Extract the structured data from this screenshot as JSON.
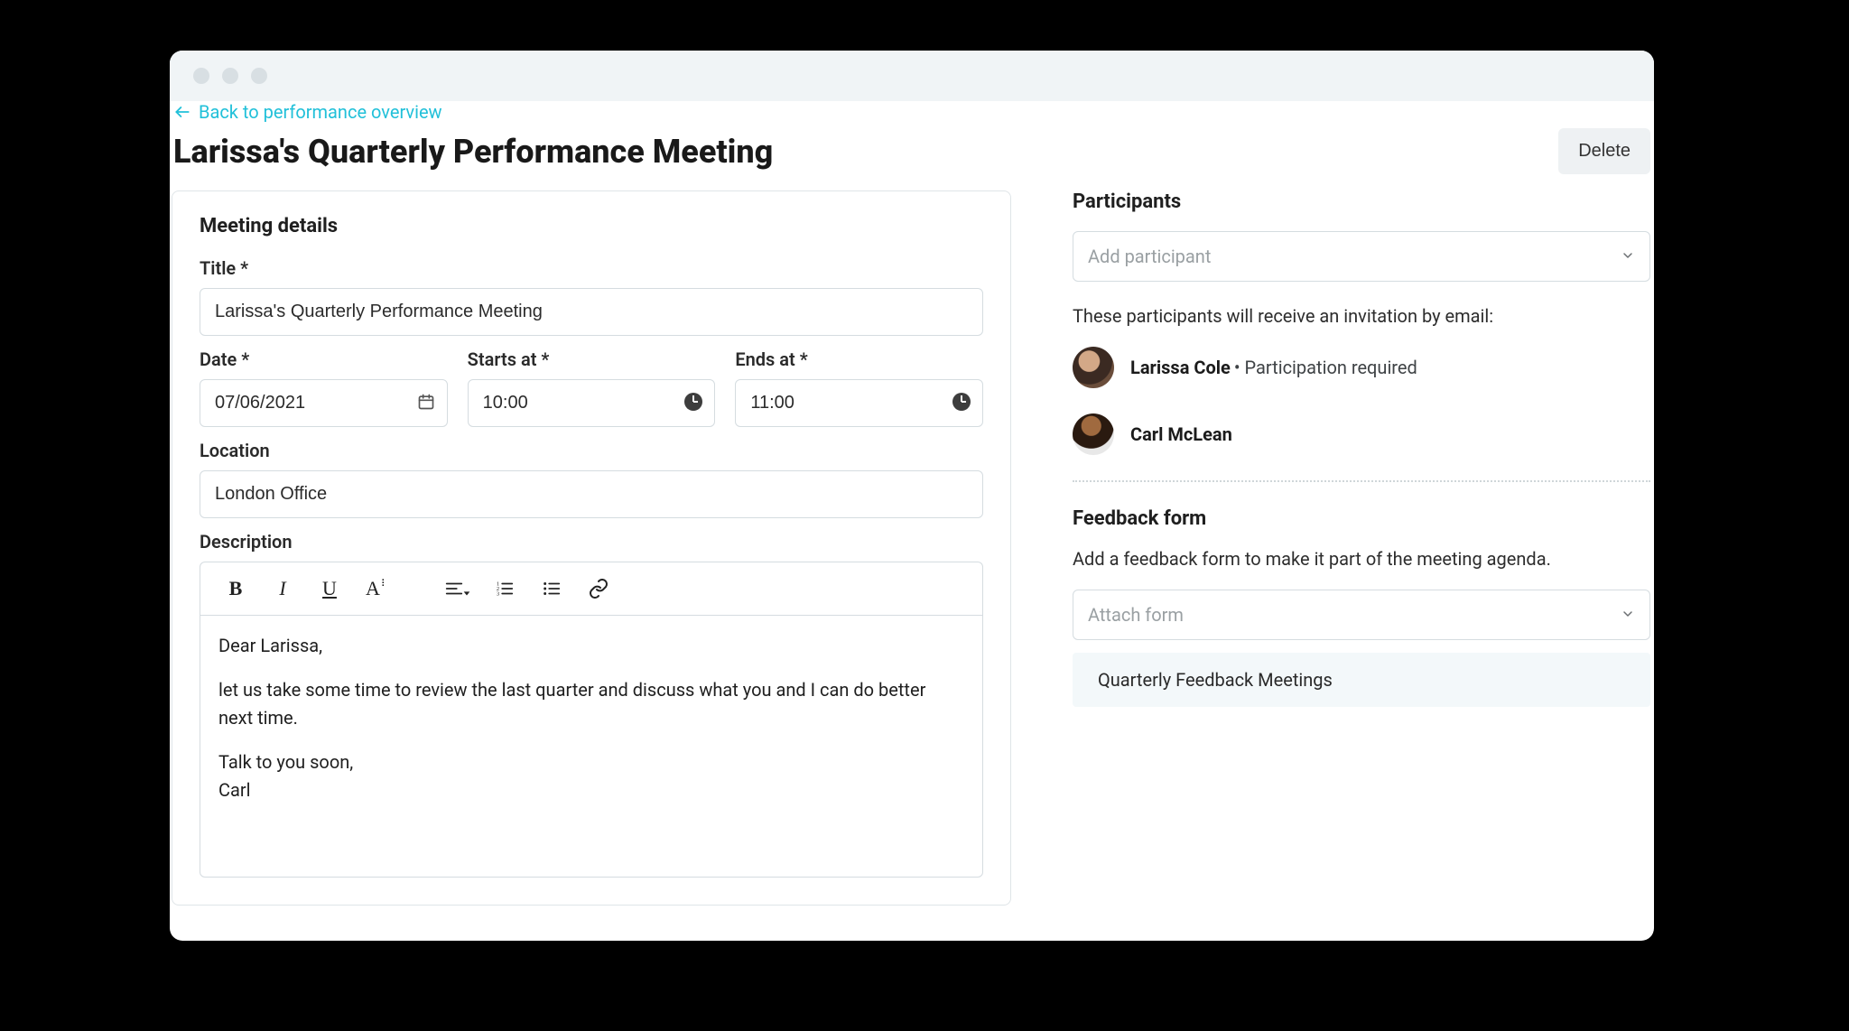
{
  "nav": {
    "back_label": "Back to performance overview"
  },
  "header": {
    "title": "Larissa's Quarterly Performance Meeting",
    "delete_label": "Delete"
  },
  "details": {
    "heading": "Meeting details",
    "title_label": "Title *",
    "title_value": "Larissa's Quarterly Performance Meeting",
    "date_label": "Date *",
    "date_value": "07/06/2021",
    "starts_label": "Starts at *",
    "starts_value": "10:00",
    "ends_label": "Ends at *",
    "ends_value": "11:00",
    "location_label": "Location",
    "location_value": "London Office",
    "description_label": "Description",
    "body_line1": "Dear Larissa,",
    "body_line2": "let us take some time to review the last quarter and discuss what you and I can do better next time.",
    "body_line3": "Talk to you soon,",
    "body_line4": "Carl"
  },
  "participants": {
    "heading": "Participants",
    "add_placeholder": "Add participant",
    "hint": "These participants will receive an invitation by email:",
    "list": [
      {
        "name": "Larissa Cole",
        "note": "Participation required"
      },
      {
        "name": "Carl McLean",
        "note": ""
      }
    ]
  },
  "feedback": {
    "heading": "Feedback form",
    "hint": "Add a feedback form to make it part of the meeting agenda.",
    "attach_placeholder": "Attach form",
    "attached": "Quarterly Feedback Meetings"
  }
}
